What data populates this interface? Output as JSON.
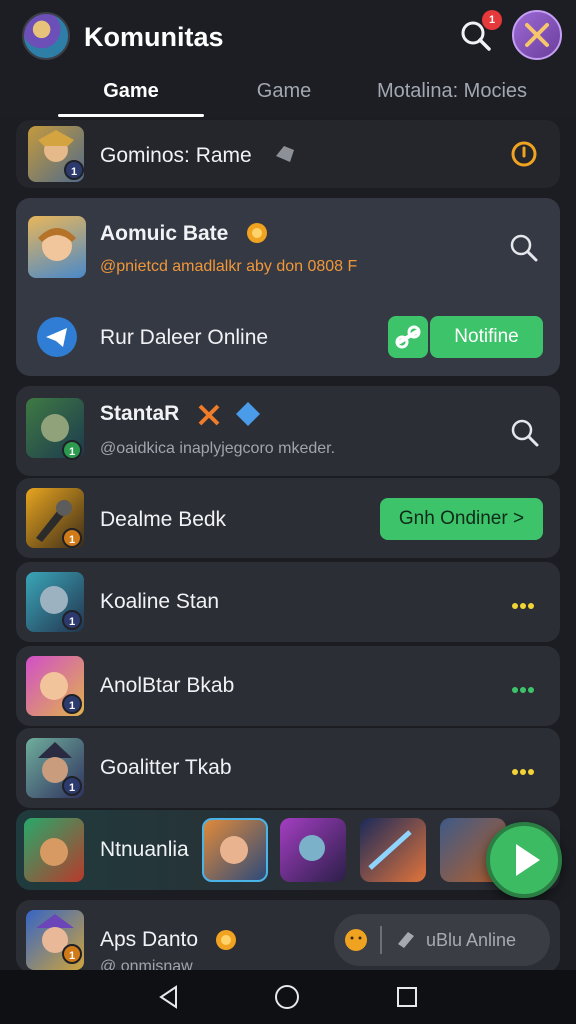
{
  "header": {
    "title": "Komunitas",
    "notification_count": "1",
    "tabs": [
      "Game",
      "Game",
      "Motalina: Mocies"
    ]
  },
  "rows": [
    {
      "title": "Gominos: Rame"
    },
    {
      "title": "Aomuic Bate",
      "subtitle": "@pnietcd amadlalkr aby don 0808 F",
      "search": true
    },
    {
      "title": "Rur Daleer Online",
      "button_label": "Notifine"
    },
    {
      "title": "StantaR",
      "subtitle": "@oaidkica inaplyjegcoro mkeder.",
      "search": true
    },
    {
      "title": "Dealme Bedk",
      "button_label": "Gnh Ondiner >"
    },
    {
      "title": "Koaline Stan",
      "dots_color": "#f3d437"
    },
    {
      "title": "AnolBtar Bkab",
      "dots_color": "#3dc46a"
    },
    {
      "title": "Goalitter Tkab",
      "dots_color": "#f3d437"
    },
    {
      "title": "Ntnuanlia"
    },
    {
      "title": "Aps Danto",
      "subtitle": "@ onmisnaw"
    }
  ],
  "badges": [
    "1",
    "1",
    "1",
    "1",
    "1",
    "1",
    "1"
  ],
  "pill": {
    "label": "uBlu Anline"
  },
  "colors": {
    "accent_green": "#3dc46a",
    "alert_orange": "#f0a320",
    "background": "#1b1d22",
    "card": "#2b2e35"
  }
}
